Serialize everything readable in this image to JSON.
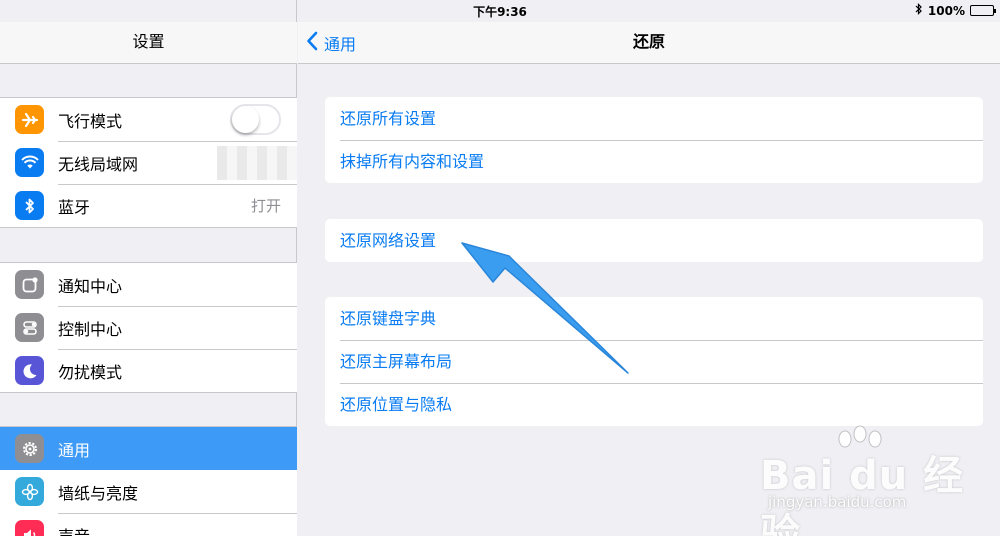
{
  "status_bar": {
    "device": "iPad",
    "time": "下午9:36",
    "battery": "100%",
    "battery_level": 1.0
  },
  "left_nav": {
    "title": "设置"
  },
  "sidebar": {
    "groups": [
      {
        "items": [
          {
            "label": "飞行模式",
            "icon": "airplane-icon",
            "color": "#ff9500",
            "control": "toggle",
            "toggle_on": false
          },
          {
            "label": "无线局域网",
            "icon": "wifi-icon",
            "color": "#0a7cf2",
            "value": ""
          },
          {
            "label": "蓝牙",
            "icon": "bluetooth-icon",
            "color": "#0a7cf2",
            "value": "打开"
          }
        ]
      },
      {
        "items": [
          {
            "label": "通知中心",
            "icon": "notification-icon",
            "color": "#8e8e93"
          },
          {
            "label": "控制中心",
            "icon": "control-center-icon",
            "color": "#8e8e93"
          },
          {
            "label": "勿扰模式",
            "icon": "moon-icon",
            "color": "#5856d6"
          }
        ]
      },
      {
        "items": [
          {
            "label": "通用",
            "icon": "gear-icon",
            "color": "#8e8e93",
            "selected": true
          },
          {
            "label": "墙纸与亮度",
            "icon": "flower-icon",
            "color": "#34aadc"
          },
          {
            "label": "声音",
            "icon": "speaker-icon",
            "color": "#ff2d55"
          }
        ]
      }
    ]
  },
  "main_nav": {
    "back_label": "通用",
    "title": "还原"
  },
  "main": {
    "sections": [
      {
        "items": [
          "还原所有设置",
          "抹掉所有内容和设置"
        ]
      },
      {
        "items": [
          "还原网络设置"
        ]
      },
      {
        "items": [
          "还原键盘字典",
          "还原主屏幕布局",
          "还原位置与隐私"
        ]
      }
    ]
  },
  "annotation": {
    "arrow_color": "#3a9df0"
  },
  "watermark": {
    "brand": "Bai du 经验",
    "url": "jingyan.baidu.com"
  }
}
